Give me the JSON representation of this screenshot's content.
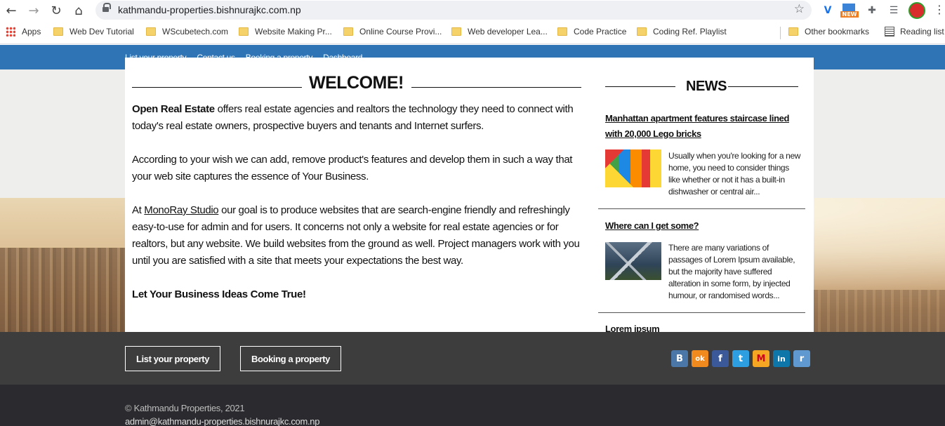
{
  "browser": {
    "url": "kathmandu-properties.bishnurajkc.com.np",
    "bookmarks": [
      {
        "label": "Apps"
      },
      {
        "label": "Web Dev Tutorial"
      },
      {
        "label": "WScubetech.com"
      },
      {
        "label": "Website Making Pr..."
      },
      {
        "label": "Online Course Provi..."
      },
      {
        "label": "Web developer Lea..."
      },
      {
        "label": "Code Practice"
      },
      {
        "label": "Coding Ref. Playlist"
      }
    ],
    "other_bookmarks": "Other bookmarks",
    "reading_list": "Reading list",
    "ext_badge": "NEW"
  },
  "topnav": {
    "items": [
      "List your property",
      "Contact us",
      "Booking a property",
      "Dashboard"
    ]
  },
  "welcome": {
    "title": "WELCOME!",
    "p1_bold": "Open Real Estate",
    "p1_rest": " offers real estate agencies and realtors the technology they need to connect with today's real estate owners, prospective buyers and tenants and Internet surfers.",
    "p2": "According to your wish we can add, remove product's features and develop them in such a way that your web site captures the essence of Your Business.",
    "p3_start": "At ",
    "p3_link": "MonoRay Studio",
    "p3_rest": " our goal is to produce websites that are search-engine friendly and refreshingly easy-to-use for admin and for users. It concerns not only a website for real estate agencies or for realtors, but any website. We build websites from the ground as well. Project managers work with you until you are satisfied with a site that meets your expectations the best way.",
    "p4_bold": "Let Your Business Ideas Come True!"
  },
  "news": {
    "title": "NEWS",
    "items": [
      {
        "headline": "Manhattan apartment features staircase lined with 20,000 Lego bricks",
        "text": "Usually when you're looking for a new home, you need to consider things like whether or not it has a built-in dishwasher or central air..."
      },
      {
        "headline": "Where can I get some?",
        "text": "There are many variations of passages of Lorem Ipsum available, but the majority have suffered alteration in some form, by injected humour, or randomised words..."
      },
      {
        "headline": "Lorem ipsum"
      }
    ]
  },
  "footer": {
    "btn_list": "List your property",
    "btn_booking": "Booking a property",
    "social": [
      {
        "label": "B",
        "color": "#4a76a8"
      },
      {
        "label": "ok",
        "color": "#f18a1e"
      },
      {
        "label": "f",
        "color": "#3b5998"
      },
      {
        "label": "t",
        "color": "#2d9fe0"
      },
      {
        "label": "М",
        "color": "#f5a623"
      },
      {
        "label": "in",
        "color": "#0e76a8"
      },
      {
        "label": "r",
        "color": "#5f99cf"
      }
    ],
    "copyright": "© Kathmandu Properties, 2021",
    "email": "admin@kathmandu-properties.bishnurajkc.com.np"
  }
}
